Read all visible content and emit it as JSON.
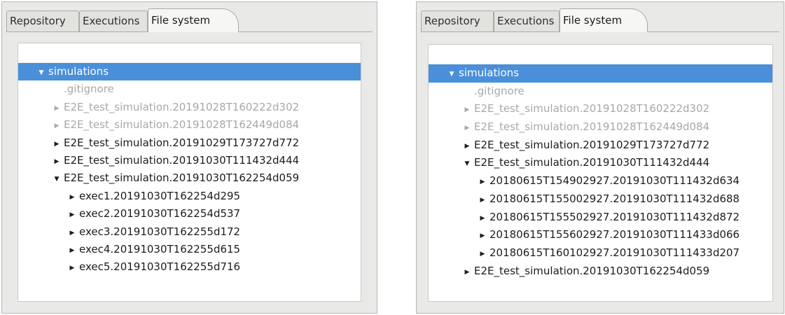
{
  "left": {
    "tabs": [
      {
        "label": "Repository"
      },
      {
        "label": "Executions"
      },
      {
        "label": "File system"
      }
    ],
    "tree": [
      {
        "label": "simulations",
        "arrow": "▼",
        "level": 0,
        "selected": true,
        "dim": false
      },
      {
        "label": ".gitignore",
        "arrow": "",
        "level": 1,
        "selected": false,
        "dim": true
      },
      {
        "label": "E2E_test_simulation.20191028T160222d302",
        "arrow": "▶",
        "level": 1,
        "selected": false,
        "dim": true
      },
      {
        "label": "E2E_test_simulation.20191028T162449d084",
        "arrow": "▶",
        "level": 1,
        "selected": false,
        "dim": true
      },
      {
        "label": "E2E_test_simulation.20191029T173727d772",
        "arrow": "▶",
        "level": 1,
        "selected": false,
        "dim": false
      },
      {
        "label": "E2E_test_simulation.20191030T111432d444",
        "arrow": "▶",
        "level": 1,
        "selected": false,
        "dim": false
      },
      {
        "label": "E2E_test_simulation.20191030T162254d059",
        "arrow": "▼",
        "level": 1,
        "selected": false,
        "dim": false
      },
      {
        "label": "exec1.20191030T162254d295",
        "arrow": "▶",
        "level": 2,
        "selected": false,
        "dim": false
      },
      {
        "label": "exec2.20191030T162254d537",
        "arrow": "▶",
        "level": 2,
        "selected": false,
        "dim": false
      },
      {
        "label": "exec3.20191030T162255d172",
        "arrow": "▶",
        "level": 2,
        "selected": false,
        "dim": false
      },
      {
        "label": "exec4.20191030T162255d615",
        "arrow": "▶",
        "level": 2,
        "selected": false,
        "dim": false
      },
      {
        "label": "exec5.20191030T162255d716",
        "arrow": "▶",
        "level": 2,
        "selected": false,
        "dim": false
      }
    ]
  },
  "right": {
    "tabs": [
      {
        "label": "Repository"
      },
      {
        "label": "Executions"
      },
      {
        "label": "File system"
      }
    ],
    "tree": [
      {
        "label": "simulations",
        "arrow": "▼",
        "level": 0,
        "selected": true,
        "dim": false
      },
      {
        "label": ".gitignore",
        "arrow": "",
        "level": 1,
        "selected": false,
        "dim": true
      },
      {
        "label": "E2E_test_simulation.20191028T160222d302",
        "arrow": "▶",
        "level": 1,
        "selected": false,
        "dim": true
      },
      {
        "label": "E2E_test_simulation.20191028T162449d084",
        "arrow": "▶",
        "level": 1,
        "selected": false,
        "dim": true
      },
      {
        "label": "E2E_test_simulation.20191029T173727d772",
        "arrow": "▶",
        "level": 1,
        "selected": false,
        "dim": false
      },
      {
        "label": "E2E_test_simulation.20191030T111432d444",
        "arrow": "▼",
        "level": 1,
        "selected": false,
        "dim": false
      },
      {
        "label": "20180615T154902927.20191030T111432d634",
        "arrow": "▶",
        "level": 2,
        "selected": false,
        "dim": false
      },
      {
        "label": "20180615T155002927.20191030T111432d688",
        "arrow": "▶",
        "level": 2,
        "selected": false,
        "dim": false
      },
      {
        "label": "20180615T155502927.20191030T111432d872",
        "arrow": "▶",
        "level": 2,
        "selected": false,
        "dim": false
      },
      {
        "label": "20180615T155602927.20191030T111433d066",
        "arrow": "▶",
        "level": 2,
        "selected": false,
        "dim": false
      },
      {
        "label": "20180615T160102927.20191030T111433d207",
        "arrow": "▶",
        "level": 2,
        "selected": false,
        "dim": false
      },
      {
        "label": "E2E_test_simulation.20191030T162254d059",
        "arrow": "▶",
        "level": 1,
        "selected": false,
        "dim": false
      }
    ]
  },
  "colors": {
    "selection": "#4a8fd9",
    "dimmed_text": "#a8a8a8",
    "panel_bg": "#e9e9e7"
  }
}
